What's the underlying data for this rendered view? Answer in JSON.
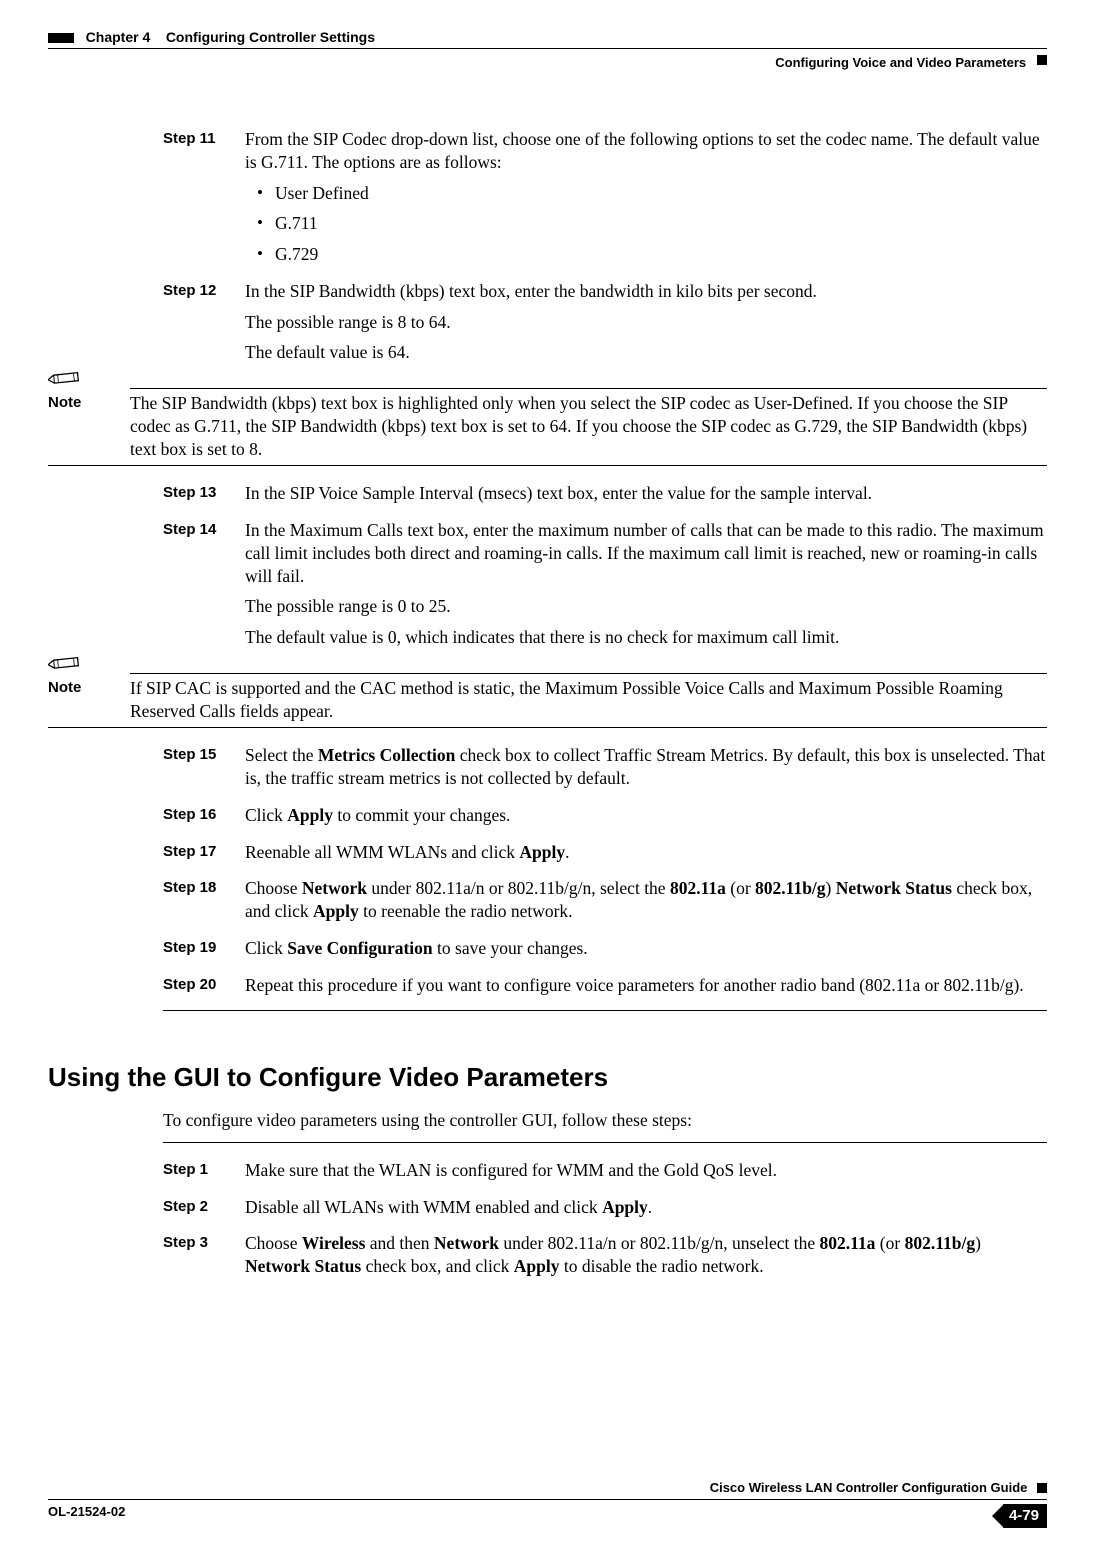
{
  "header": {
    "chapter": "Chapter 4",
    "chapter_title": "Configuring Controller Settings",
    "section": "Configuring Voice and Video Parameters"
  },
  "steps_a": [
    {
      "num": "Step 11",
      "paras": [
        "From the SIP Codec drop-down list, choose one of the following options to set the codec name. The default value is G.711. The options are as follows:"
      ],
      "bullets": [
        "User Defined",
        "G.711",
        "G.729"
      ]
    },
    {
      "num": "Step 12",
      "paras": [
        "In the SIP Bandwidth (kbps) text box, enter the bandwidth in kilo bits per second.",
        "The possible range is 8 to 64.",
        "The default value is 64."
      ]
    }
  ],
  "note1": {
    "label": "Note",
    "text": "The SIP Bandwidth (kbps) text box is highlighted only when you select the SIP codec as User-Defined. If you choose the SIP codec as G.711, the SIP Bandwidth (kbps) text box is set to 64. If you choose the SIP codec as G.729, the SIP Bandwidth (kbps) text box is set to 8."
  },
  "steps_b": [
    {
      "num": "Step 13",
      "paras": [
        "In the SIP Voice Sample Interval (msecs) text box, enter the value for the sample interval."
      ]
    },
    {
      "num": "Step 14",
      "paras": [
        "In the Maximum Calls text box, enter the maximum number of calls that can be made to this radio. The maximum call limit includes both direct and roaming-in calls. If the maximum call limit is reached, new or roaming-in calls will fail.",
        "The possible range is 0 to 25.",
        "The default value is 0, which indicates that there is no check for maximum call limit."
      ]
    }
  ],
  "note2": {
    "label": "Note",
    "text": "If SIP CAC is supported and the CAC method is static, the Maximum Possible Voice Calls and Maximum Possible Roaming Reserved Calls fields appear."
  },
  "steps_c": [
    {
      "num": "Step 15",
      "html": "Select the <span class=\"bold\">Metrics Collection</span> check box to collect Traffic Stream Metrics. By default, this box is unselected. That is, the traffic stream metrics is not collected by default."
    },
    {
      "num": "Step 16",
      "html": "Click <span class=\"bold\">Apply</span> to commit your changes."
    },
    {
      "num": "Step 17",
      "html": "Reenable all WMM WLANs and click <span class=\"bold\">Apply</span>."
    },
    {
      "num": "Step 18",
      "html": "Choose <span class=\"bold\">Network</span> under 802.11a/n or 802.11b/g/n, select the <span class=\"bold\">802.11a</span> (or <span class=\"bold\">802.11b/g</span>) <span class=\"bold\">Network Status</span> check box, and click <span class=\"bold\">Apply</span> to reenable the radio network."
    },
    {
      "num": "Step 19",
      "html": "Click <span class=\"bold\">Save Configuration</span> to save your changes."
    },
    {
      "num": "Step 20",
      "html": "Repeat this procedure if you want to configure voice parameters for another radio band (802.11a or 802.11b/g)."
    }
  ],
  "section2": {
    "title": "Using the GUI to Configure Video Parameters",
    "intro": "To configure video parameters using the controller GUI, follow these steps:"
  },
  "steps_d": [
    {
      "num": "Step 1",
      "html": "Make sure that the WLAN is configured for WMM and the Gold QoS level."
    },
    {
      "num": "Step 2",
      "html": "Disable all WLANs with WMM enabled and click <span class=\"bold\">Apply</span>."
    },
    {
      "num": "Step 3",
      "html": "Choose <span class=\"bold\">Wireless</span> and then <span class=\"bold\">Network</span> under 802.11a/n or 802.11b/g/n, unselect the <span class=\"bold\">802.11a</span> (or <span class=\"bold\">802.11b/g</span>) <span class=\"bold\">Network Status</span> check box, and click <span class=\"bold\">Apply</span> to disable the radio network."
    }
  ],
  "footer": {
    "guide": "Cisco Wireless LAN Controller Configuration Guide",
    "doc": "OL-21524-02",
    "page": "4-79"
  }
}
